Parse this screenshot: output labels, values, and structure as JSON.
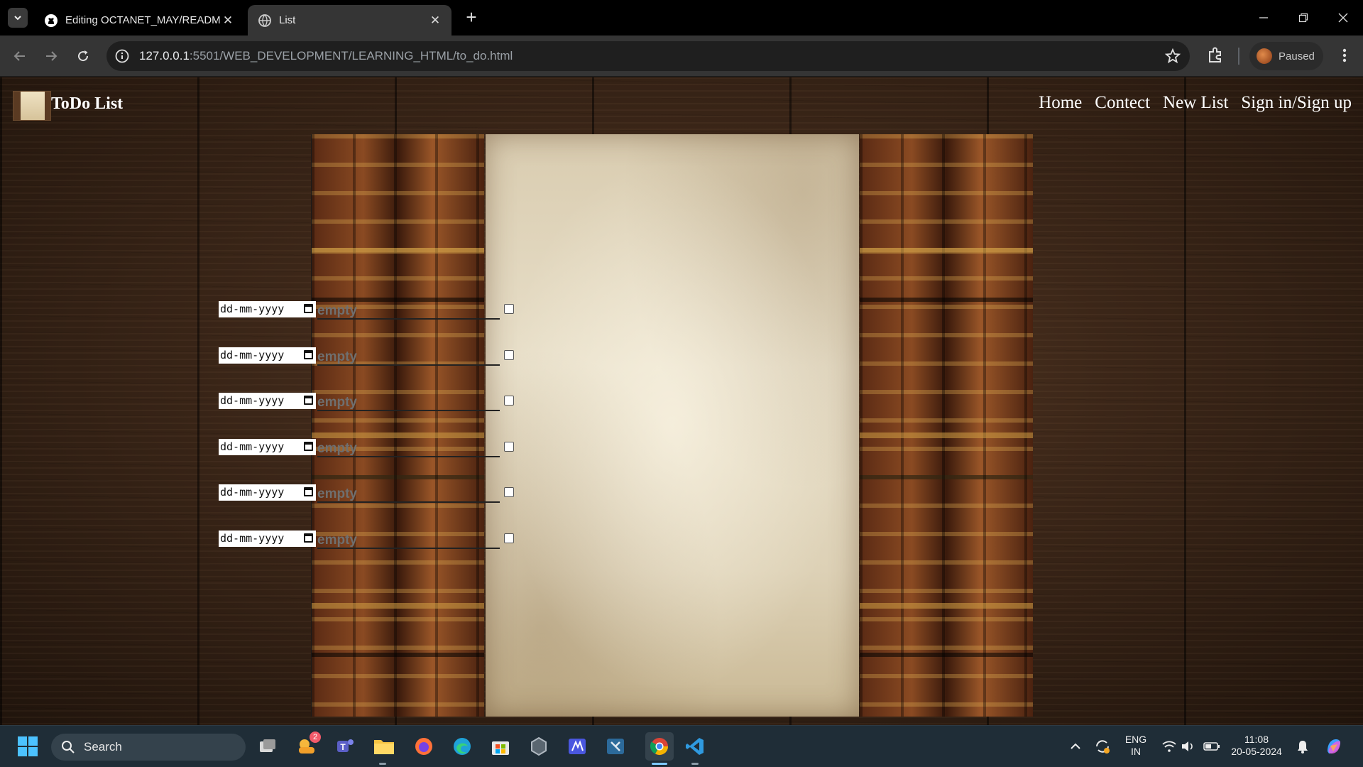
{
  "browser": {
    "tabs": [
      {
        "title": "Editing OCTANET_MAY/READM",
        "icon": "github-icon"
      },
      {
        "title": "List",
        "icon": "globe-icon",
        "active": true
      }
    ],
    "url_host": "127.0.0.1",
    "url_path": ":5501/WEB_DEVELOPMENT/LEARNING_HTML/to_do.html",
    "profile_label": "Paused"
  },
  "site": {
    "brand": "ToDo List",
    "nav": [
      "Home",
      "Contect",
      "New List",
      "Sign in/Sign up"
    ]
  },
  "todo": {
    "rows": [
      {
        "date_placeholder": "dd-mm-yyyy",
        "task": "empty",
        "done": false
      },
      {
        "date_placeholder": "dd-mm-yyyy",
        "task": "empty",
        "done": false
      },
      {
        "date_placeholder": "dd-mm-yyyy",
        "task": "empty",
        "done": false
      },
      {
        "date_placeholder": "dd-mm-yyyy",
        "task": "empty",
        "done": false
      },
      {
        "date_placeholder": "dd-mm-yyyy",
        "task": "empty",
        "done": false
      },
      {
        "date_placeholder": "dd-mm-yyyy",
        "task": "empty",
        "done": false
      }
    ]
  },
  "taskbar": {
    "search_label": "Search",
    "widgets_badge": "2",
    "lang_line1": "ENG",
    "lang_line2": "IN",
    "time": "11:08",
    "date": "20-05-2024"
  }
}
